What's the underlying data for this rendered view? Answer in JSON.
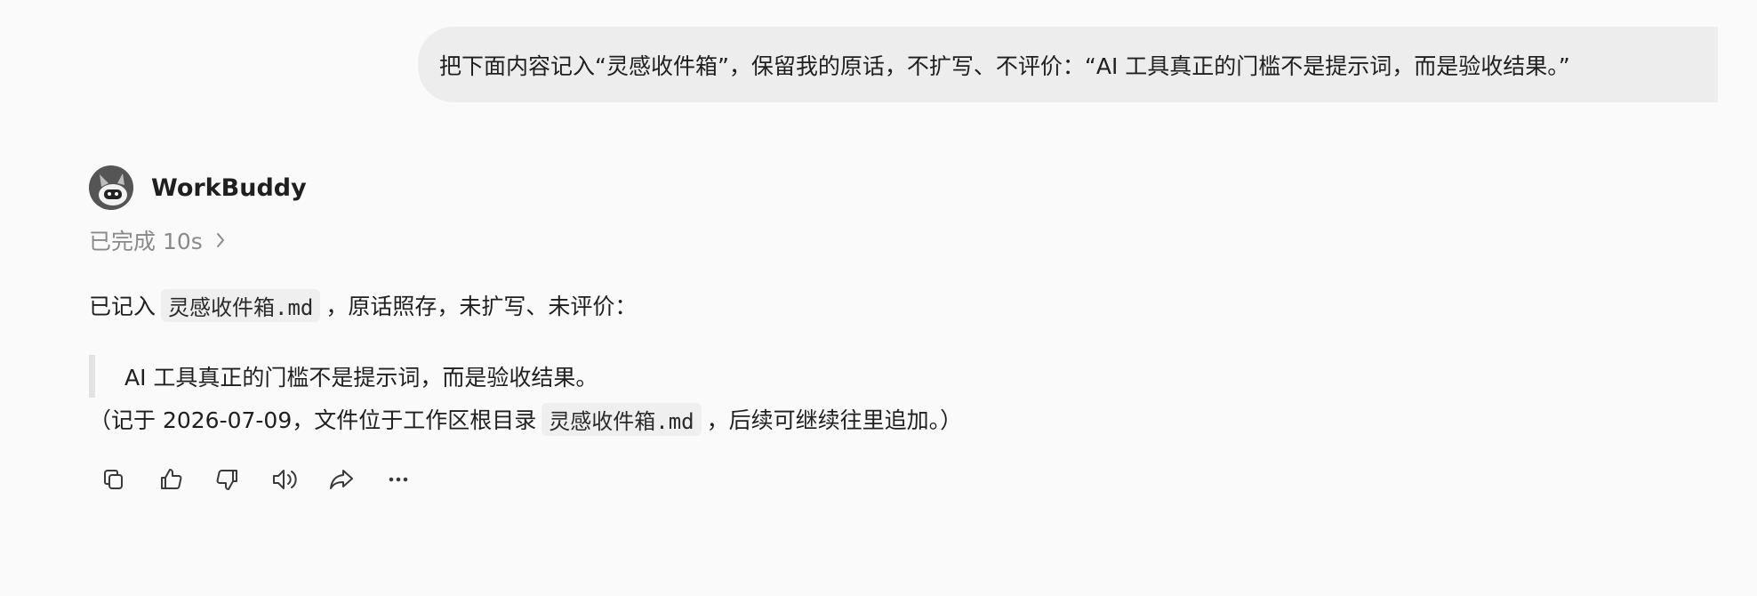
{
  "user_message": {
    "text": "把下面内容记入“灵感收件箱”，保留我的原话，不扩写、不评价：“AI 工具真正的门槛不是提示词，而是验收结果。”"
  },
  "assistant": {
    "name": "WorkBuddy",
    "avatar_icon": "robot-avatar-icon",
    "status": "已完成 10s",
    "reply": {
      "prefix": "已记入",
      "file_name": "灵感收件箱.md",
      "suffix": "，原话照存，未扩写、未评价："
    },
    "quote": "AI 工具真正的门槛不是提示词，而是验收结果。",
    "note": {
      "prefix": "（记于 2026-07-09，文件位于工作区根目录",
      "file_name": "灵感收件箱.md",
      "suffix": "，后续可继续往里追加。）"
    }
  },
  "actions": [
    {
      "name": "copy",
      "icon": "copy-icon"
    },
    {
      "name": "like",
      "icon": "thumbs-up-icon"
    },
    {
      "name": "dislike",
      "icon": "thumbs-down-icon"
    },
    {
      "name": "read-aloud",
      "icon": "speaker-icon"
    },
    {
      "name": "share",
      "icon": "share-icon"
    },
    {
      "name": "more",
      "icon": "more-icon"
    }
  ],
  "colors": {
    "background": "#fafafa",
    "user_bubble": "#ededed",
    "status_text": "#8a8a8a",
    "quote_bar": "#e3e3e3",
    "code_chip": "#efefef"
  }
}
